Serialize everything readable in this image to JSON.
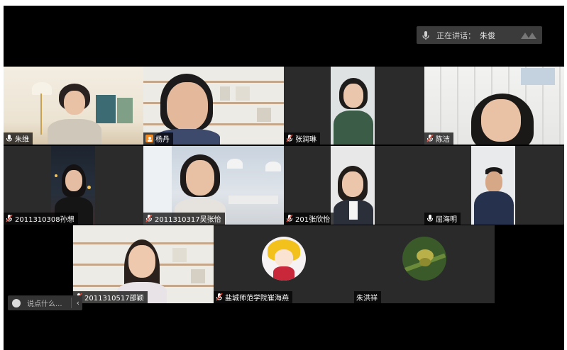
{
  "speaking_bar": {
    "label": "正在讲话：",
    "speaker": "朱俊"
  },
  "participants": [
    {
      "name": "朱维",
      "muted": false
    },
    {
      "name": "杨丹",
      "muted": false
    },
    {
      "name": "张润琳",
      "muted": true
    },
    {
      "name": "陈洁",
      "muted": true
    },
    {
      "name": "2011310308孙想",
      "muted": true
    },
    {
      "name": "2011310317吴张怡",
      "muted": true
    },
    {
      "name": "201张欣怡",
      "muted": true
    },
    {
      "name": "屈海明",
      "muted": false
    },
    {
      "name": "2011310517邵颖",
      "muted": true
    },
    {
      "name": "盐城师范学院崔海燕",
      "muted": true
    },
    {
      "name": "朱洪祥",
      "muted": false
    }
  ],
  "chat": {
    "placeholder": "说点什么...",
    "collapse_glyph": "‹"
  },
  "colors": {
    "background": "#000000",
    "tile": "#2a2a2a",
    "active_border": "#2ecc71",
    "camera_badge": "#f08a24",
    "muted_red": "#e74c3c"
  }
}
